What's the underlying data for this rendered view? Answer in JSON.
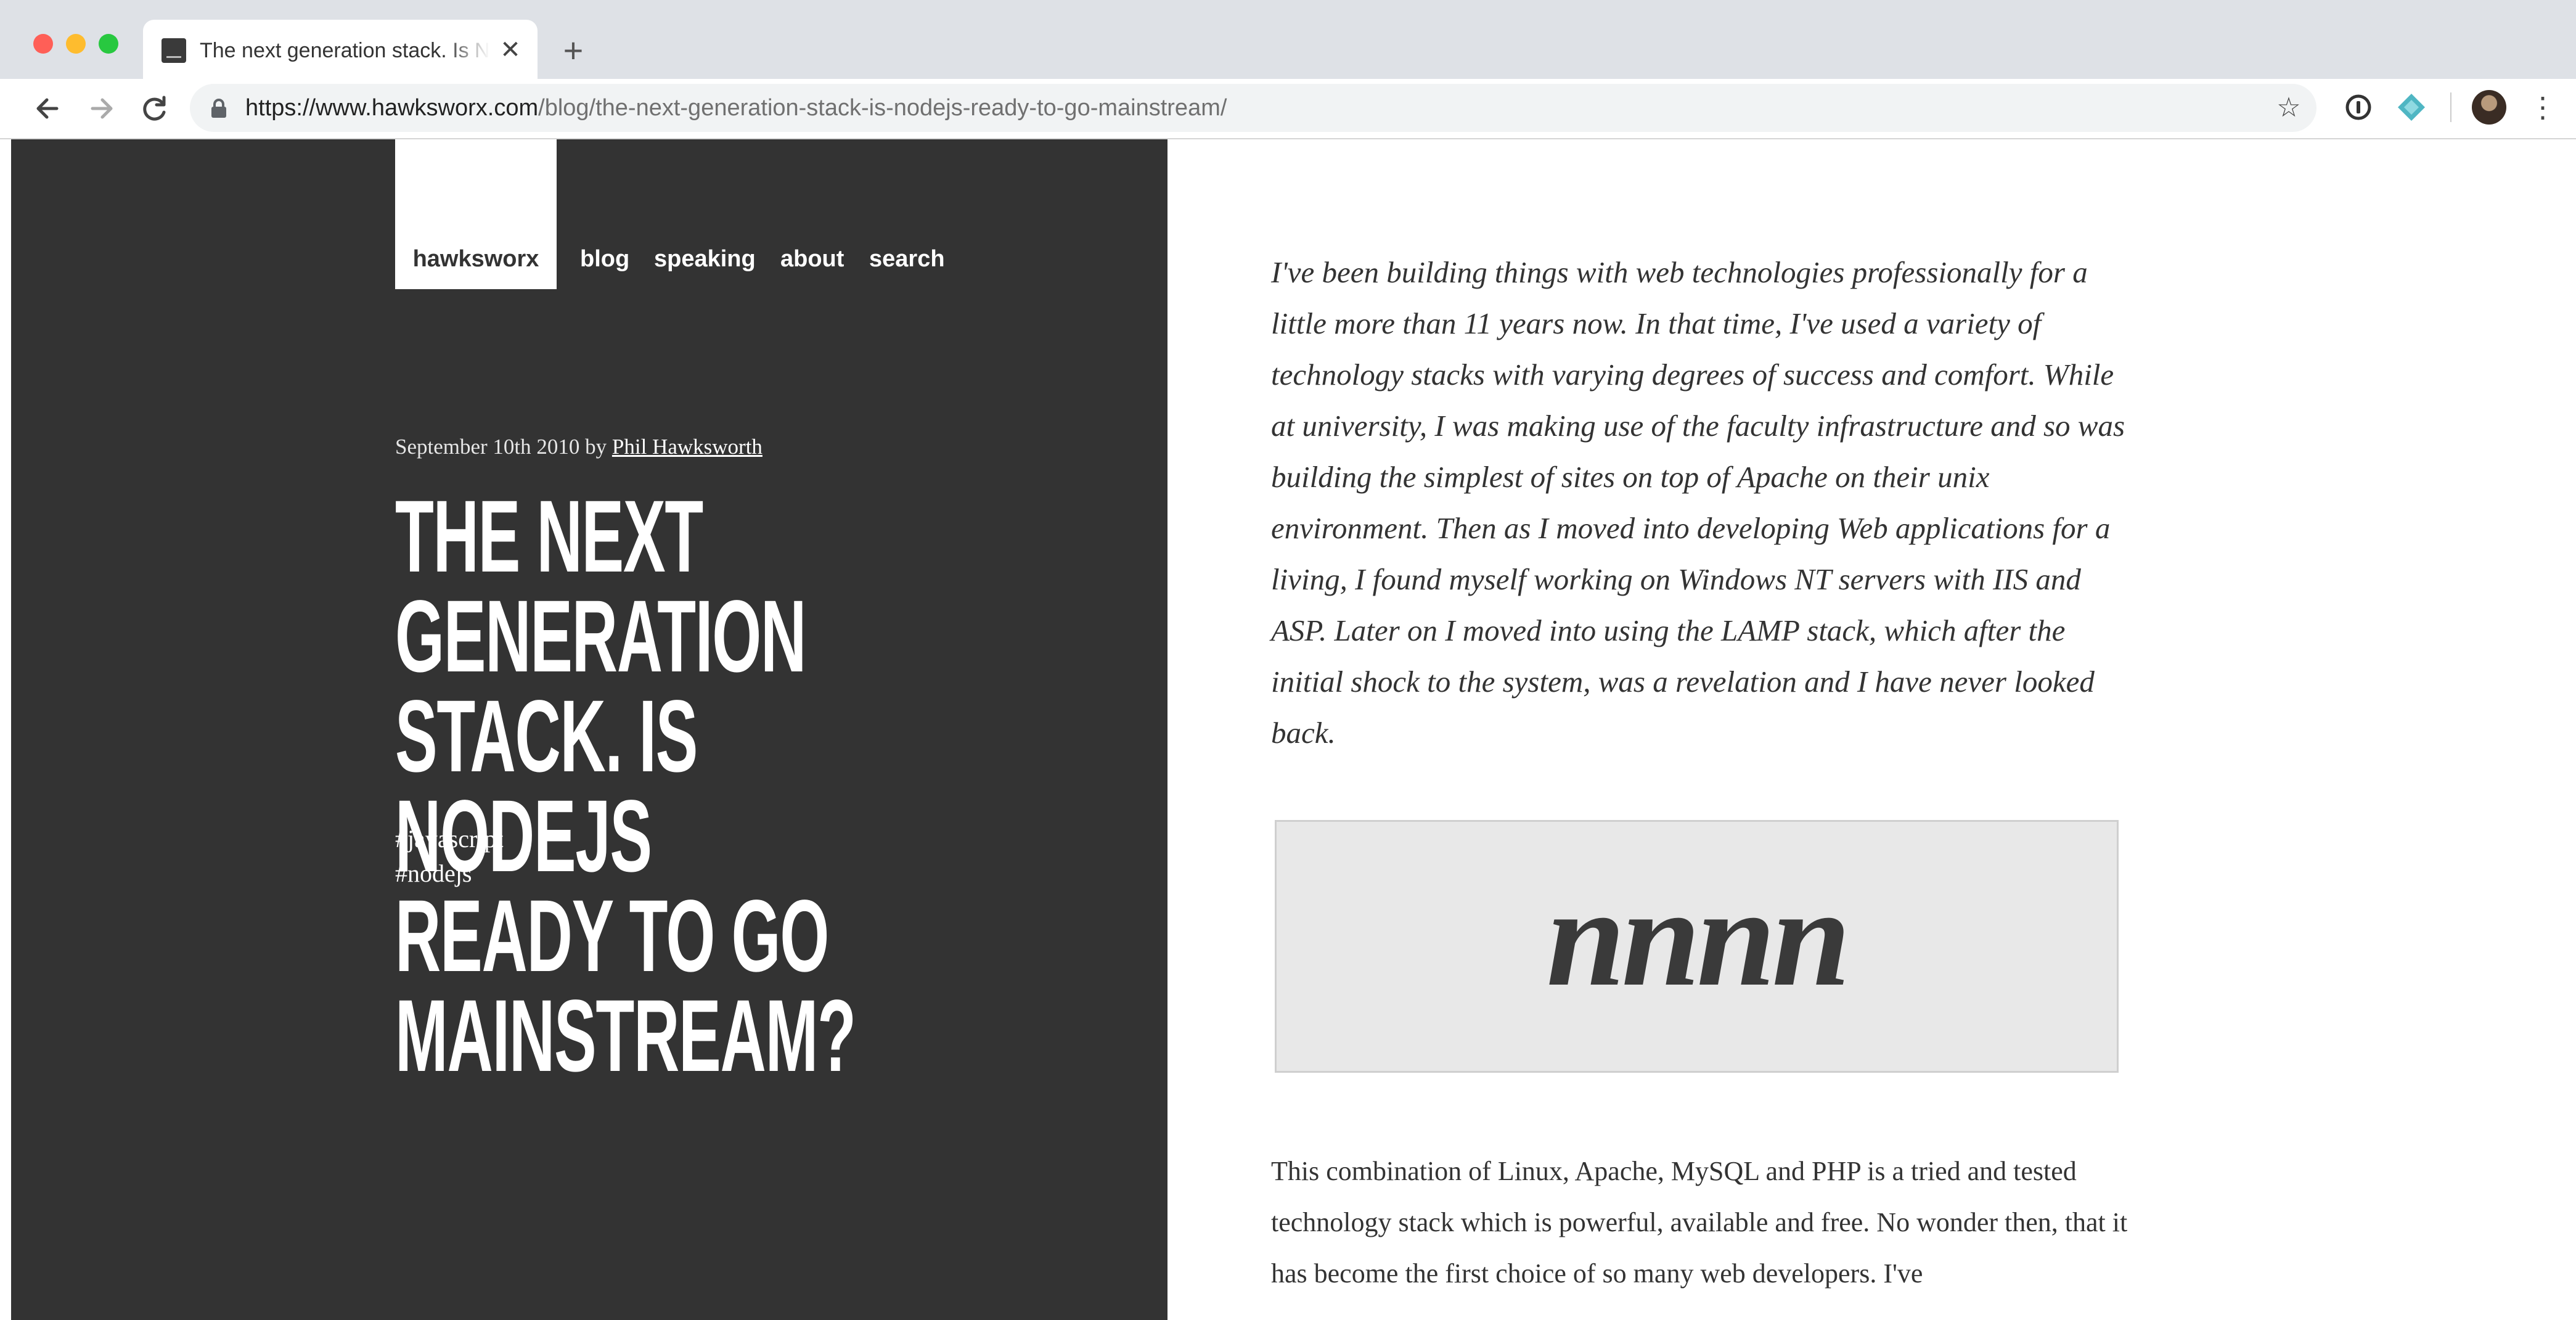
{
  "browser": {
    "tab_title": "The next generation stack. Is NodeJS ready to go mainstream?",
    "tab_close": "✕",
    "new_tab": "+",
    "url_host": "https://www.hawksworx.com",
    "url_path": "/blog/the-next-generation-stack-is-nodejs-ready-to-go-mainstream/",
    "back_icon": "arrow-left",
    "forward_icon": "arrow-right",
    "reload_icon": "reload",
    "bookmark_icon": "star-outline",
    "menu_icon": "kebab-menu",
    "colors": {
      "tabstrip": "#dee1e6",
      "close": "#ff5f57",
      "minimize": "#febc2e",
      "zoom": "#28c840",
      "teal_extension": "#4fb6c3"
    }
  },
  "site": {
    "logo": "hawksworx",
    "nav": [
      "blog",
      "speaking",
      "about",
      "search"
    ],
    "colors": {
      "sidebar_bg": "#333333"
    }
  },
  "post": {
    "date": "September 10th 2010",
    "by": "by",
    "author": "Phil Hawksworth",
    "title": "The next generation stack. Is NodeJS ready to go mainstream?",
    "tags": [
      "#javascript",
      "#nodejs"
    ],
    "intro": "I've been building things with web technologies professionally for a little more than 11 years now. In that time, I've used a variety of technology stacks with varying degrees of success and comfort. While at university, I was making use of the faculty infrastructure and so was building the simplest of sites on top of Apache on their unix environment. Then as I moved into developing Web applications for a living, I found myself working on Windows NT servers with IIS and ASP. Later on I moved into using the LAMP stack, which after the initial shock to the system, was a revelation and I have never looked back.",
    "image_text": "nnnn",
    "paragraph": "This combination of Linux, Apache, MySQL and PHP is a tried and tested technology stack which is powerful, available and free. No wonder then, that it has become the first choice of so many web developers. I've"
  }
}
